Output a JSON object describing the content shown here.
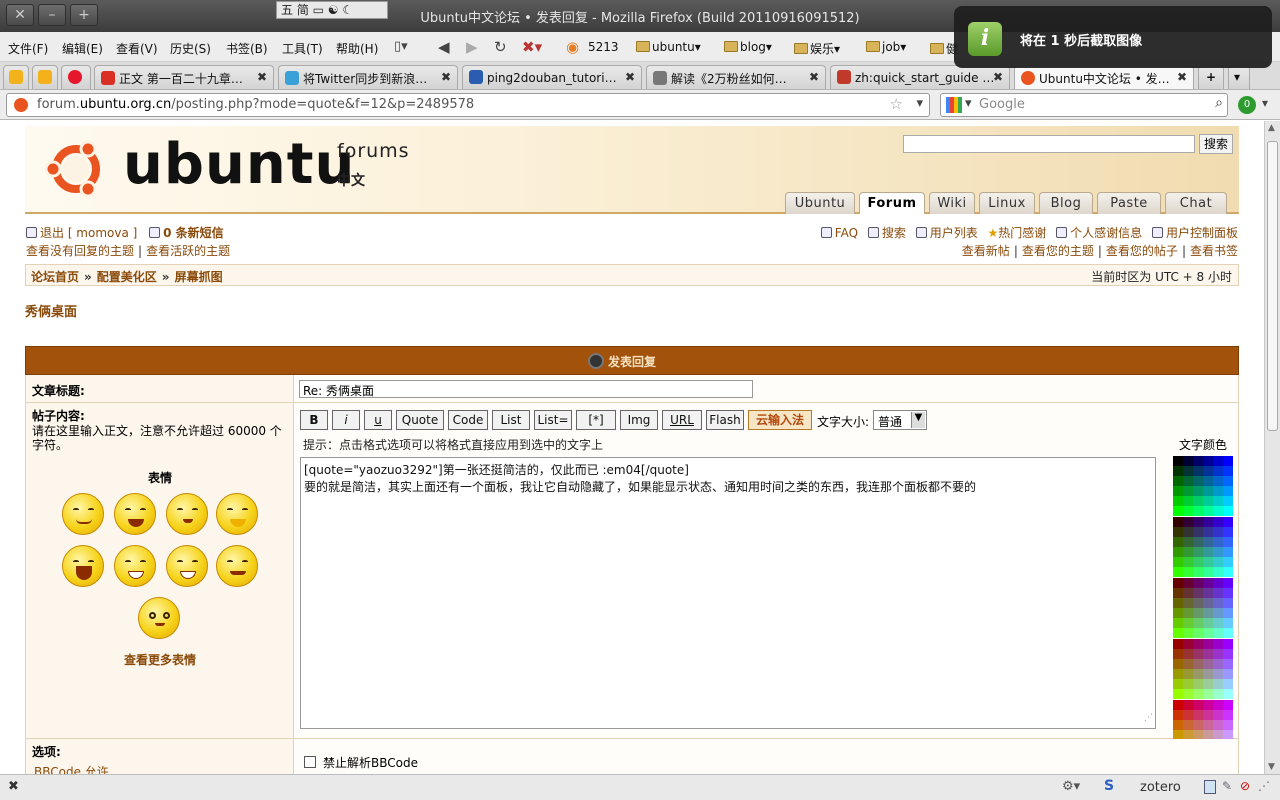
{
  "window": {
    "title": "Ubuntu中文论坛 • 发表回复 - Mozilla Firefox (Build 20110916091512)",
    "ime_indicator": "五 简 ▭ ☯ ☾"
  },
  "notification": {
    "text": "将在  1  秒后截取图像"
  },
  "menu": [
    "文件(F)",
    "编辑(E)",
    "查看(V)",
    "历史(S)",
    "书签(B)",
    "工具(T)",
    "帮助(H)"
  ],
  "rss_count": "5213",
  "bookmarks": [
    "ubuntu",
    "blog",
    "娱乐",
    "job",
    "健"
  ],
  "tabs": [
    {
      "label": "正文 第一百二十九章…",
      "favicon": "#d93025"
    },
    {
      "label": "将Twitter同步到新浪…",
      "favicon": "#3aa0d8"
    },
    {
      "label": "ping2douban_tutori…",
      "favicon": "#2a5db0"
    },
    {
      "label": "解读《2万粉丝如何…",
      "favicon": "#777777"
    },
    {
      "label": "zh:quick_start_guide …",
      "favicon": "#c0392b"
    },
    {
      "label": "Ubuntu中文论坛 • 发…",
      "favicon": "#e95420"
    }
  ],
  "url": {
    "prefix": "forum.",
    "host": "ubuntu.org.cn",
    "path": "/posting.php?mode=quote&f=12&p=2489578"
  },
  "search_engine": {
    "placeholder": "Google"
  },
  "addon_badge": "0",
  "banner": {
    "logo_text": "ubuntu",
    "sub1": "forums",
    "sub2": "中文",
    "search_button": "搜索",
    "nav_tabs": [
      "Ubuntu",
      "Forum",
      "Wiki",
      "Linux",
      "Blog",
      "Paste",
      "Chat"
    ],
    "active_tab": "Forum"
  },
  "user_links": {
    "logout": "退出 [ momova ]",
    "messages": "0 条新短信",
    "no_reply": "查看没有回复的主题",
    "active": "查看活跃的主题"
  },
  "right_links": {
    "faq": "FAQ",
    "search": "搜索",
    "members": "用户列表",
    "thanks": "热门感谢",
    "my_thanks": "个人感谢信息",
    "ucp": "用户控制面板",
    "new_posts": "查看新帖",
    "your_topics": "查看您的主题",
    "your_posts": "查看您的帖子",
    "bookmarks": "查看书签"
  },
  "breadcrumb": [
    "论坛首页",
    "配置美化区",
    "屏幕抓图"
  ],
  "timezone": "当前时区为 UTC + 8 小时",
  "topic_title": "秀俩桌面",
  "post_header": "发表回复",
  "form": {
    "subject_label": "文章标题:",
    "subject_value": "Re: 秀俩桌面",
    "content_label": "帖子内容:",
    "content_hint": "请在这里输入正文，注意不允许超过 60000 个字符。",
    "content_limit": "60000",
    "toolbar": [
      "B",
      "i",
      "u",
      "Quote",
      "Code",
      "List",
      "List=",
      "[*]",
      "Img",
      "URL",
      "Flash",
      "云输入法"
    ],
    "font_size_label": "文字大小:",
    "font_size_value": "普通",
    "format_hint": "提示：点击格式选项可以将格式直接应用到选中的文字上",
    "color_label": "文字颜色",
    "text_line1": "[quote=\"yaozuo3292\"]第一张还挺简洁的，仅此而已 :em04[/quote]",
    "text_line2": "要的就是简洁，其实上面还有一个面板，我让它自动隐藏了，如果能显示状态、通知用时间之类的东西，我连那个面板都不要的",
    "emoticons_label": "表情",
    "more_emoticons": "查看更多表情",
    "options_label": "选项:",
    "bbcode_note": "BBCode 允许",
    "opt_disable_bbcode": "禁止解析BBCode"
  },
  "statusbar": {
    "zotero": "zotero"
  }
}
